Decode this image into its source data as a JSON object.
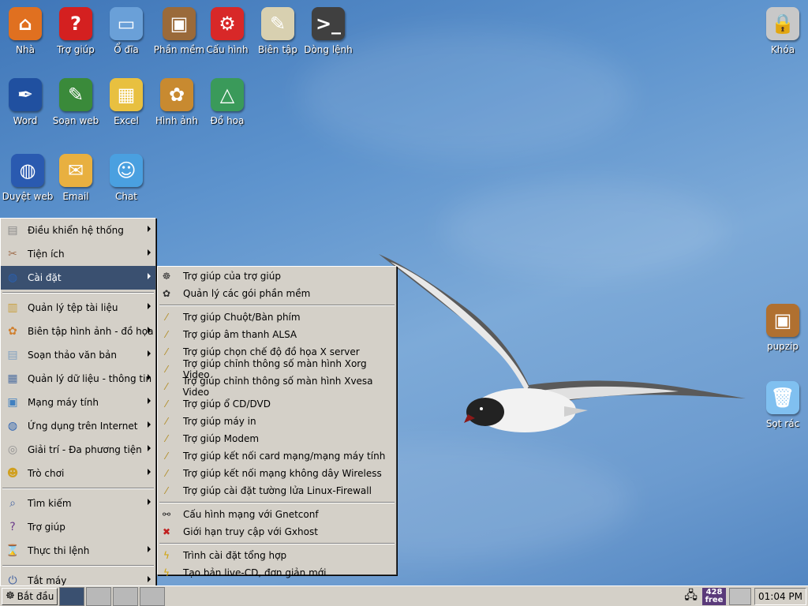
{
  "desktop": {
    "icons_row1": [
      {
        "label": "Nhà",
        "icon": "home-icon",
        "color": "#e07020",
        "glyph": "⌂"
      },
      {
        "label": "Trợ giúp",
        "icon": "help-icon",
        "color": "#d42020",
        "glyph": "?"
      },
      {
        "label": "Ổ đĩa",
        "icon": "usb-drive-icon",
        "color": "#6aa0d8",
        "glyph": "▭"
      },
      {
        "label": "Phần mềm",
        "icon": "software-package-icon",
        "color": "#9a6a3a",
        "glyph": "▣"
      },
      {
        "label": "Cấu hình",
        "icon": "config-icon",
        "color": "#d82828",
        "glyph": "⚙"
      },
      {
        "label": "Biên tập",
        "icon": "text-editor-icon",
        "color": "#d8d0b0",
        "glyph": "✎"
      },
      {
        "label": "Dòng lệnh",
        "icon": "terminal-icon",
        "color": "#404040",
        "glyph": ">_"
      }
    ],
    "icons_row2": [
      {
        "label": "Word",
        "icon": "word-processor-icon",
        "color": "#2050a0",
        "glyph": "✒"
      },
      {
        "label": "Soạn web",
        "icon": "web-editor-icon",
        "color": "#3a8a3a",
        "glyph": "✎"
      },
      {
        "label": "Excel",
        "icon": "spreadsheet-icon",
        "color": "#e8c040",
        "glyph": "▦"
      },
      {
        "label": "Hình ảnh",
        "icon": "paint-palette-icon",
        "color": "#c88a30",
        "glyph": "✿"
      },
      {
        "label": "Đồ hoạ",
        "icon": "drawing-icon",
        "color": "#3a9a5a",
        "glyph": "△"
      }
    ],
    "icons_row3": [
      {
        "label": "Duyệt web",
        "icon": "globe-icon",
        "color": "#2a5ab0",
        "glyph": "◍"
      },
      {
        "label": "Email",
        "icon": "email-icon",
        "color": "#e8b040",
        "glyph": "✉"
      },
      {
        "label": "Chat",
        "icon": "chat-icon",
        "color": "#4aa0e0",
        "glyph": "☺"
      }
    ],
    "right_icons": [
      {
        "label": "Khóa",
        "icon": "lock-screen-icon",
        "color": "#c8c8c8",
        "glyph": "🔒"
      },
      {
        "label": "pupzip",
        "icon": "archive-box-icon",
        "color": "#b07030",
        "glyph": "▣"
      },
      {
        "label": "Sọt rác",
        "icon": "trash-icon",
        "color": "#80c0f0",
        "glyph": "🗑"
      }
    ]
  },
  "start_menu": {
    "items": [
      {
        "label": "Điều khiển hệ thống",
        "icon": "system-control-icon",
        "glyph": "▤",
        "has_sub": true
      },
      {
        "label": "Tiện ích",
        "icon": "utilities-icon",
        "glyph": "✂",
        "has_sub": true
      },
      {
        "label": "Cài đặt",
        "icon": "setup-icon",
        "glyph": "◍",
        "has_sub": true,
        "selected": true
      },
      {
        "label": "Quản lý tệp tài liệu",
        "icon": "file-manager-icon",
        "glyph": "▥",
        "has_sub": true
      },
      {
        "label": "Biên tập hình ảnh - đồ họa",
        "icon": "graphics-icon",
        "glyph": "✿",
        "has_sub": true
      },
      {
        "label": "Soạn thảo văn bản",
        "icon": "document-icon",
        "glyph": "▤",
        "has_sub": true
      },
      {
        "label": "Quản lý dữ liệu - thông tin",
        "icon": "data-manager-icon",
        "glyph": "▦",
        "has_sub": true
      },
      {
        "label": "Mạng máy tính",
        "icon": "network-icon",
        "glyph": "▣",
        "has_sub": true
      },
      {
        "label": "Ứng dụng trên Internet",
        "icon": "internet-icon",
        "glyph": "◍",
        "has_sub": true
      },
      {
        "label": "Giải trí - Đa phương tiện",
        "icon": "multimedia-icon",
        "glyph": "◎",
        "has_sub": true
      },
      {
        "label": "Trò chơi",
        "icon": "games-icon",
        "glyph": "☻",
        "has_sub": true
      },
      {
        "label": "Tìm kiếm",
        "icon": "search-icon",
        "glyph": "⌕",
        "has_sub": true
      },
      {
        "label": "Trợ giúp",
        "icon": "help-book-icon",
        "glyph": "?",
        "has_sub": false
      },
      {
        "label": "Thực thi lệnh",
        "icon": "run-command-icon",
        "glyph": "⌛",
        "has_sub": true
      },
      {
        "label": "Tắt máy",
        "icon": "shutdown-icon",
        "glyph": "⏻",
        "has_sub": true
      }
    ]
  },
  "submenu": {
    "groups": [
      [
        {
          "label": "Trợ giúp của trợ giúp",
          "icon": "wizard-help-icon",
          "glyph": "☸"
        },
        {
          "label": "Quản lý các gói phần mềm",
          "icon": "package-manager-icon",
          "glyph": "✿"
        }
      ],
      [
        {
          "label": "Trợ giúp Chuột/Bàn phím",
          "icon": "magic-wand-icon",
          "glyph": "⁄"
        },
        {
          "label": "Trợ giúp âm thanh ALSA",
          "icon": "magic-wand-icon",
          "glyph": "⁄"
        },
        {
          "label": "Trợ giúp chọn chế độ đồ họa X server",
          "icon": "magic-wand-icon",
          "glyph": "⁄"
        },
        {
          "label": "Trợ giúp chỉnh thông số màn hình Xorg Video",
          "icon": "magic-wand-icon",
          "glyph": "⁄"
        },
        {
          "label": "Trợ giúp chỉnh thông số màn hình Xvesa Video",
          "icon": "magic-wand-icon",
          "glyph": "⁄"
        },
        {
          "label": "Trợ giúp ổ CD/DVD",
          "icon": "magic-wand-icon",
          "glyph": "⁄"
        },
        {
          "label": "Trợ giúp máy in",
          "icon": "magic-wand-icon",
          "glyph": "⁄"
        },
        {
          "label": "Trợ giúp Modem",
          "icon": "magic-wand-icon",
          "glyph": "⁄"
        },
        {
          "label": "Trợ giúp kết nối card mạng/mạng máy tính",
          "icon": "magic-wand-icon",
          "glyph": "⁄"
        },
        {
          "label": "Trợ giúp kết nối mạng không dây Wireless",
          "icon": "magic-wand-icon",
          "glyph": "⁄"
        },
        {
          "label": "Trợ giúp cài đặt tường lửa Linux-Firewall",
          "icon": "magic-wand-icon",
          "glyph": "⁄"
        }
      ],
      [
        {
          "label": "Cấu hình mạng với Gnetconf",
          "icon": "network-config-icon",
          "glyph": "⚯"
        },
        {
          "label": "Giới hạn truy cập với Gxhost",
          "icon": "access-block-icon",
          "glyph": "✖"
        }
      ],
      [
        {
          "label": "Trình cài đặt tổng hợp",
          "icon": "lightning-icon",
          "glyph": "ϟ"
        },
        {
          "label": "Tạo bản live-CD, đơn giản mới",
          "icon": "lightning-icon",
          "glyph": "ϟ"
        }
      ]
    ]
  },
  "taskbar": {
    "start_label": "Bắt đầu",
    "free_line1": "428",
    "free_line2": "free",
    "clock": "01:04 PM"
  }
}
